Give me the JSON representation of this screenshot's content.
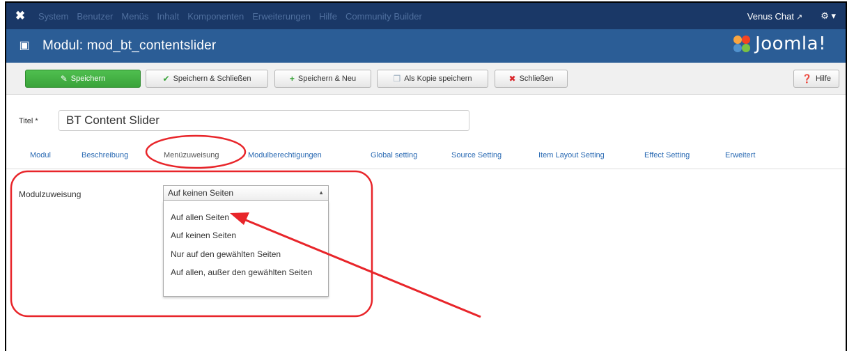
{
  "navbar": {
    "menu": [
      "System",
      "Benutzer",
      "Menüs",
      "Inhalt",
      "Komponenten",
      "Erweiterungen",
      "Hilfe",
      "Community Builder"
    ],
    "user_label": "Venus Chat",
    "settings_icon": "gear-icon"
  },
  "header": {
    "title": "Modul: mod_bt_contentslider",
    "brand": "Joomla!"
  },
  "toolbar": {
    "save": "Speichern",
    "save_close": "Speichern & Schließen",
    "save_new": "Speichern & Neu",
    "save_copy": "Als Kopie speichern",
    "close": "Schließen",
    "help": "Hilfe"
  },
  "form": {
    "title_label": "Titel *",
    "title_value": "BT Content Slider"
  },
  "tabs": [
    "Modul",
    "Beschreibung",
    "Menüzuweisung",
    "Modulberechtigungen",
    "Global setting",
    "Source Setting",
    "Item Layout Setting",
    "Effect Setting",
    "Erweitert"
  ],
  "assignment": {
    "label": "Modulzuweisung",
    "selected": "Auf keinen Seiten",
    "options": [
      "Auf allen Seiten",
      "Auf keinen Seiten",
      "Nur auf den gewählten Seiten",
      "Auf allen, außer den gewählten Seiten"
    ]
  },
  "colors": {
    "navbar": "#1a3867",
    "titlebar": "#2b5d96",
    "save_button": "#3aa33a",
    "annotation": "#e8252a",
    "link": "#2a6ab3"
  }
}
